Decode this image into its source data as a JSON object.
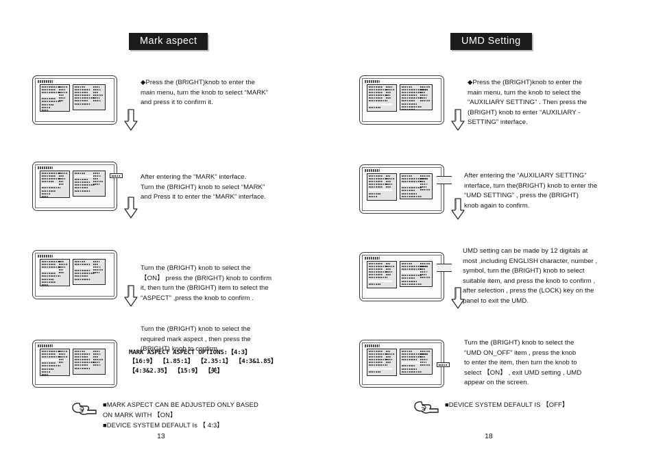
{
  "document": {
    "type": "instruction-manual-spread",
    "columns": [
      {
        "id": "mark-aspect",
        "banner": "Mark aspect",
        "page_number": "13",
        "steps": [
          {
            "index": 1,
            "text": "◆Press the (BRIGHT)knob to enter the\nmain menu,  turn the knob to select  “MARK”\nand press it to confirm it.",
            "arrow": "down-arrow"
          },
          {
            "index": 2,
            "text": "     After entering the  “MARK” interface.\nTurn the (BRIGHT) knob to select “MARK”\nand Press it to enter the “MARK” interface.",
            "arrow": "down-arrow"
          },
          {
            "index": 3,
            "text": "     Turn the (BRIGHT) knob to select the\n【ON】 press the (BRIGHT) knob to confirm\nit, then turn the (BRIGHT) item to select the\n “ASPECT” ,press the knob to confirm .",
            "arrow": "down-arrow"
          },
          {
            "index": 4,
            "text": "    Turn the (BRIGHT) knob to select the\nrequired mark aspect , then press the\n(BRIGHT) knob to confirm .",
            "options": "MARK ASPECT ASPECT OPTIONS:【4:3】\n 【16:9】 【1.85:1】 【2.35:1】 【4:3&1.85】\n 【4:3&2.35】 【15:9】 【关】",
            "arrow": "none"
          }
        ],
        "footer": {
          "icon": "pointing-hand-icon",
          "lines": "■MARK ASPECT CAN BE ADJUSTED ONLY BASED\n ON MARK WITH 【ON】\n■DEVICE SYSTEM DEFAULT Is 【 4:3】"
        }
      },
      {
        "id": "umd-setting",
        "banner": "UMD  Setting",
        "page_number": "18",
        "steps": [
          {
            "index": 1,
            "text": "◆Press the (BRIGHT)knob to enter the\nmain menu, turn the knob to select the\n  “AUXILIARY SETTING” . Then press the\n(BRIGHT) knob to enter “AUXILIARY -\nSETTING” interface.",
            "arrow": "down-arrow"
          },
          {
            "index": 2,
            "text": "     After entering the  “AUXILIARY SETTING”\ninterface, turn the(BRIGHT) knob to enter the\n  “UMD SETTING” , press the (BRIGHT)\nknob again to confirm.",
            "arrow": "down-arrow"
          },
          {
            "index": 3,
            "text": "     UMD setting can be made by 12 digitals at\nmost ,including  ENGLISH character, number ,\nsymbol, turn the (BRIGHT) knob to select\nsuitable item, and press the knob to confirm ,\nafter selection , press the (LOCK) key on the\npanel to exit the UMD.",
            "arrow": "down-arrow"
          },
          {
            "index": 4,
            "text": "     Turn the (BRIGHT) knob  to select the\n  “UMD ON_OFF”  item , press  the knob\n to enter the item, then turn the knob to\nselect 【ON】 , exit  UMD setting , UMD\nappear  on the screen.",
            "arrow": "none"
          }
        ],
        "footer": {
          "icon": "pointing-hand-icon",
          "lines": "■DEVICE SYSTEM DEFAULT IS 【OFF】"
        }
      }
    ]
  },
  "colors": {
    "banner_bg": "#1b1b1b",
    "banner_text": "#ffffff",
    "text": "#141414",
    "osd_panel": "#e4e4e4",
    "osd_border": "#222222",
    "page_bg": "#ffffff"
  }
}
